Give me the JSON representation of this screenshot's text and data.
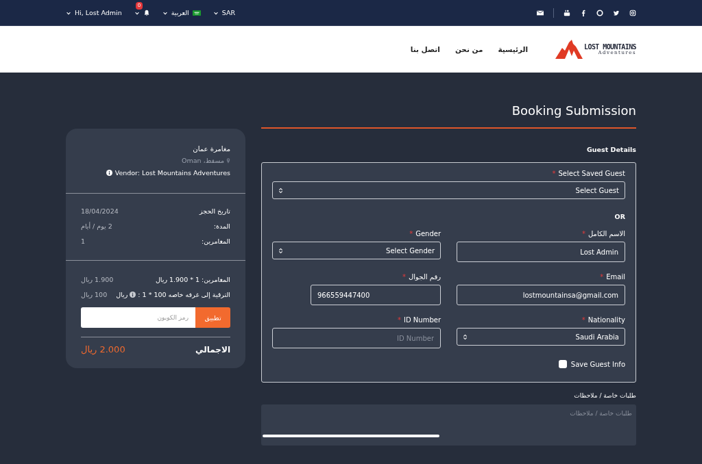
{
  "top_bar": {
    "user_menu": "Hi, Lost Admin",
    "notifications": {
      "count": "0"
    },
    "language": "العربية",
    "currency": "SAR"
  },
  "nav": {
    "logo": {
      "line_1": "LOST MOUNTAINS",
      "line_2": "Adventures"
    },
    "links": [
      {
        "label": "الرئيسية"
      },
      {
        "label": "من نحن"
      },
      {
        "label": "اتصل بنا"
      }
    ]
  },
  "page_title": "Booking Submission",
  "summary": {
    "title": "مغامرة عمان",
    "location": "مسقط، Oman",
    "vendor": "Vendor: Lost Mountains Adventures",
    "details": [
      {
        "label": "تاريخ الحجز",
        "value": "18/04/2024"
      },
      {
        "label": "المدة:",
        "value": "2 يوم / أيام"
      },
      {
        "label": "المغامرين:",
        "value": "1"
      }
    ],
    "prices": [
      {
        "label": "المغامرين: 1 * 1.900 ريال",
        "amount": "1.900 ريال"
      },
      {
        "label": "الترقية إلى غرفه خاصه 100 * 1 :",
        "info": true,
        "suffix": "ريال",
        "amount": "100 ريال"
      }
    ],
    "coupon": {
      "placeholder": "رمز الكوبون",
      "button": "تطبيق"
    },
    "total": {
      "label": "الاجمالي",
      "amount": "2.000 ريال"
    }
  },
  "form": {
    "section_title": "Guest Details",
    "saved_guest": {
      "label": "Select Saved Guest",
      "required_mark": "*",
      "kind": "select",
      "value": "Select Guest"
    },
    "or": "OR",
    "fields": [
      {
        "label": "الاسم الكامل",
        "required_mark": "*",
        "kind": "text",
        "value": "Lost Admin"
      },
      {
        "label": "Gender",
        "required_mark": "*",
        "kind": "select",
        "value": "Select Gender"
      },
      {
        "label": "Email",
        "required_mark": "*",
        "kind": "text",
        "value": "lostmountainsa@gmail.com"
      },
      {
        "label": "رقم الجوال",
        "required_mark": "*",
        "kind": "phone",
        "value": "966559447400"
      },
      {
        "label": "Nationality",
        "required_mark": "*",
        "kind": "select",
        "value": "Saudi Arabia"
      },
      {
        "label": "ID Number",
        "required_mark": "*",
        "kind": "text",
        "placeholder": "ID Number"
      }
    ],
    "save_guest": {
      "label": "Save Guest Info",
      "checked": false
    }
  },
  "notes": {
    "label": "طلبات خاصة / ملاحظات",
    "placeholder": "طلبات خاصة / ملاحظات"
  }
}
